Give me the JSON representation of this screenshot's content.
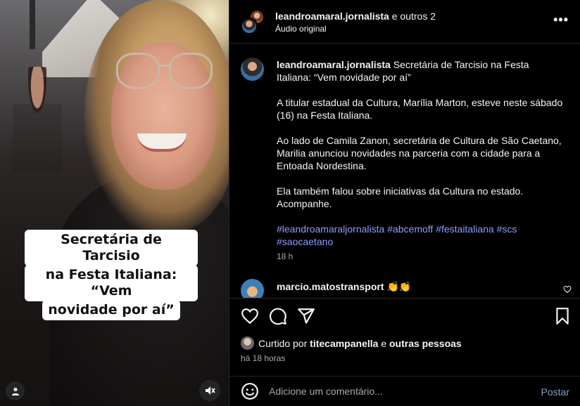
{
  "media": {
    "caption_lines": [
      "Secretária de Tarcisio",
      "na Festa Italiana: “Vem",
      "novidade por aí”"
    ],
    "user_icon": "user-icon",
    "mute_icon": "speaker-muted-icon"
  },
  "header": {
    "username": "leandroamaral.jornalista",
    "suffix": "e outros 2",
    "audio": "Áudio original",
    "more_icon": "more-horizontal-icon",
    "more_label": "•••"
  },
  "caption": {
    "username": "leandroamaral.jornalista",
    "paragraphs": [
      "Secretária de Tarcisio na Festa Italiana: “Vem novidade por aí”",
      "A titular estadual da Cultura, Marília Marton, esteve neste sábado (16) na Festa Italiana.",
      "Ao lado de Camila Zanon, secretária de Cultura de São Caetano, Marilia anunciou novidades na parceria com a cidade para a Entoada Nordestina.",
      "Ela também falou sobre iniciativas da Cultura no estado. Acompanhe."
    ],
    "hashtags": "#leandroamaraljornalista #abcemoff #festaitaliana #scs #saocaetano",
    "time": "18 h"
  },
  "comment": {
    "username": "marcio.matostransport",
    "text": "👏👏"
  },
  "actions": {
    "liked_prefix": "Curtido por",
    "liked_user": "titecampanella",
    "liked_and": "e",
    "liked_others": "outras pessoas",
    "ago": "há 18 horas"
  },
  "composer": {
    "placeholder": "Adicione um comentário...",
    "post_label": "Postar"
  },
  "colors": {
    "background": "#000000",
    "hashtag": "#8c9dfd",
    "post_button": "#85a1c6",
    "secondary_text": "#a8a8a8"
  }
}
